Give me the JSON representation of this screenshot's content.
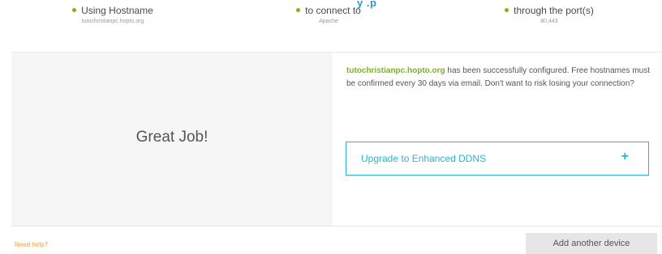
{
  "summary": {
    "hostname": {
      "label": "Using Hostname",
      "value": "tutochristianpc.hopto.org"
    },
    "connect": {
      "label": "to connect to",
      "value": "Apache"
    },
    "port": {
      "label": "through the port(s)",
      "value": "80,443"
    }
  },
  "top_partial_text": "y .p",
  "result": {
    "heading": "Great Job!",
    "message_hostname": "tutochristianpc.hopto.org",
    "message_text": " has been successfully configured. Free hostnames must be confirmed every 30 days via email. Don't want to risk losing your connection?",
    "upgrade_label": "Upgrade to Enhanced DDNS",
    "upgrade_icon": "plus-icon",
    "upgrade_plus": "+"
  },
  "footer": {
    "help_link": "Need help?",
    "add_device_label": "Add another device"
  },
  "colors": {
    "accent_green": "#7bb51e",
    "accent_blue": "#29b5d6",
    "help_orange": "#e8a03a"
  }
}
